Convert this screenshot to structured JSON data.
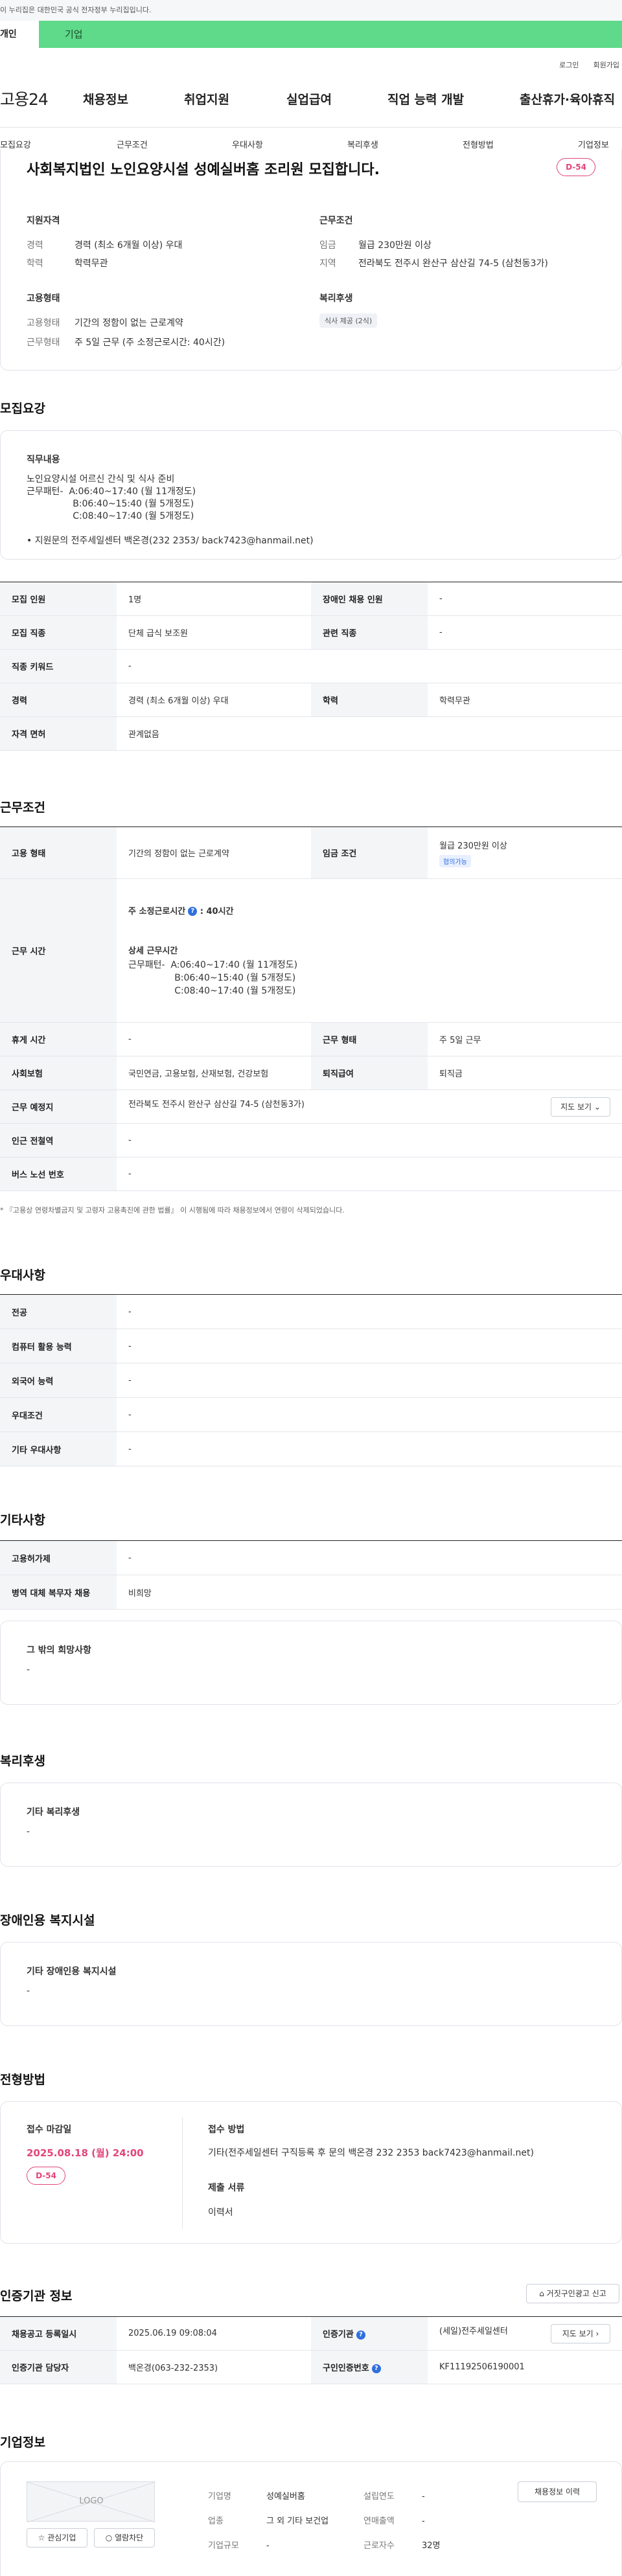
{
  "gov_notice": "이 누리집은 대한민국 공식 전자정부 누리집입니다.",
  "user_tabs": {
    "individual": "개인",
    "corporate": "기업"
  },
  "util": {
    "login": "로그인",
    "join": "회원가입"
  },
  "gnb": {
    "logo": "고용24",
    "menu": [
      "채용정보",
      "취업지원",
      "실업급여",
      "직업 능력 개발",
      "출산휴가·육아휴직"
    ]
  },
  "anchor_nav": [
    "모집요강",
    "근무조건",
    "우대사항",
    "복리후생",
    "전형방법",
    "기업정보"
  ],
  "summary": {
    "title": "사회복지법인 노인요양시설 성예실버홈 조리원 모집합니다.",
    "dday": "D-54",
    "qual_heading": "지원자격",
    "career_k": "경력",
    "career_v": "경력 (최소 6개월 이상) 우대",
    "edu_k": "학력",
    "edu_v": "학력무관",
    "cond_heading": "근무조건",
    "wage_k": "임금",
    "wage_v": "월급 230만원 이상",
    "region_k": "지역",
    "region_v": "전라북도 전주시 완산구 삼산길 74-5 (삼천동3가)",
    "emp_heading": "고용형태",
    "emptype_k": "고용형태",
    "emptype_v": "기간의 정함이 없는 근로계약",
    "worktype_k": "근무형태",
    "worktype_v": "주 5일 근무 (주 소정근로시간: 40시간)",
    "welfare_heading": "복리후생",
    "welfare_chip": "식사 제공 (2식)"
  },
  "recruit": {
    "title": "모집요강",
    "duty_heading": "직무내용",
    "duty_text": "노인요양시설 어르신 간식 및 식사 준비\n근무패턴-  A:06:40~17:40 (월 11개정도)\n                B:06:40~15:40 (월 5개정도)\n                C:08:40~17:40 (월 5개정도)\n\n• 지원문의 전주세일센터 백온경(232 2353/ back7423@hanmail.net)",
    "rows": [
      {
        "k1": "모집 인원",
        "v1": "1명",
        "k2": "장애인 채용 인원",
        "v2": "-"
      },
      {
        "k1": "모집 직종",
        "v1": "단체 급식 보조원",
        "k2": "관련 직종",
        "v2": "-"
      },
      {
        "k1": "직종 키워드",
        "v1": "-"
      },
      {
        "k1": "경력",
        "v1": "경력 (최소 6개월 이상) 우대",
        "k2": "학력",
        "v2": "학력무관"
      },
      {
        "k1": "자격 면허",
        "v1": "관계없음"
      }
    ]
  },
  "conditions": {
    "title": "근무조건",
    "emp_type_k": "고용 형태",
    "emp_type_v": "기간의 정함이 없는 근로계약",
    "wage_k": "임금 조건",
    "wage_v": "월급 230만원 이상",
    "wage_chip": "협의가능",
    "hours_k": "근무 시간",
    "hours_main": "주 소정근로시간",
    "hours_value": ": 40시간",
    "hours_detail_heading": "상세 근무시간",
    "hours_detail": "근무패턴-  A:06:40~17:40 (월 11개정도)\n                B:06:40~15:40 (월 5개정도)\n                C:08:40~17:40 (월 5개정도)",
    "rest_k": "휴게 시간",
    "rest_v": "-",
    "form_k": "근무 형태",
    "form_v": "주 5일 근무",
    "insurance_k": "사회보험",
    "insurance_v": "국민연금, 고용보험, 산재보험, 건강보험",
    "severance_k": "퇴직급여",
    "severance_v": "퇴직금",
    "place_k": "근무 예정지",
    "place_v": "전라북도 전주시 완산구 삼산길 74-5 (삼천동3가)",
    "map_btn": "지도 보기",
    "subway_k": "인근 전철역",
    "subway_v": "-",
    "bus_k": "버스 노선 번호",
    "bus_v": "-",
    "note": "* 『고용상 연령차별금지 및 고령자 고용촉진에 관한 법률』 이 시행됨에 따라 채용정보에서 연령이 삭제되었습니다."
  },
  "preference": {
    "title": "우대사항",
    "rows": [
      {
        "k": "전공",
        "v": "-"
      },
      {
        "k": "컴퓨터 활용 능력",
        "v": "-"
      },
      {
        "k": "외국어 능력",
        "v": "-"
      },
      {
        "k": "우대조건",
        "v": "-"
      },
      {
        "k": "기타 우대사항",
        "v": "-"
      }
    ]
  },
  "etc": {
    "title": "기타사항",
    "rows": [
      {
        "k": "고용허가제",
        "v": "-"
      },
      {
        "k": "병역 대체 복무자 채용",
        "v": "비희망"
      }
    ],
    "other_heading": "그 밖의 희망사항",
    "other_value": "-"
  },
  "welfare": {
    "title": "복리후생",
    "heading": "기타 복리후생",
    "value": "-"
  },
  "disabled": {
    "title": "장애인용 복지시설",
    "heading": "기타 장애인용 복지시설",
    "value": "-"
  },
  "process": {
    "title": "전형방법",
    "deadline_heading": "접수 마감일",
    "deadline_value": "2025.08.18 (월) 24:00",
    "dday": "D-54",
    "method_heading": "접수 방법",
    "method_value": "기타(전주세일센터 구직등록 후 문의 백온경 232 2353 back7423@hanmail.net)",
    "docs_heading": "제출 서류",
    "docs_value": "이력서"
  },
  "agency": {
    "title": "인증기관 정보",
    "report_btn": "거짓구인광고 신고",
    "reg_k": "채용공고 등록일시",
    "reg_v": "2025.06.19 09:08:04",
    "agency_k": "인증기관",
    "agency_v": "(세일)전주세일센터",
    "map_btn": "지도 보기",
    "manager_k": "인증기관 담당자",
    "manager_v": "백온경(063-232-2353)",
    "certno_k": "구인인증번호",
    "certno_v": "KF11192506190001"
  },
  "company": {
    "title": "기업정보",
    "logo_text": "LOGO",
    "fav_btn": "관심기업",
    "block_btn": "열람차단",
    "name_k": "기업명",
    "name_v": "성예실버홈",
    "founded_k": "설립연도",
    "founded_v": "-",
    "industry_k": "업종",
    "industry_v": "그 외 기타 보건업",
    "sales_k": "연매출액",
    "sales_v": "-",
    "size_k": "기업규모",
    "size_v": "-",
    "employees_k": "근로자수",
    "employees_v": "32명",
    "history_btn": "채용정보 이력"
  }
}
